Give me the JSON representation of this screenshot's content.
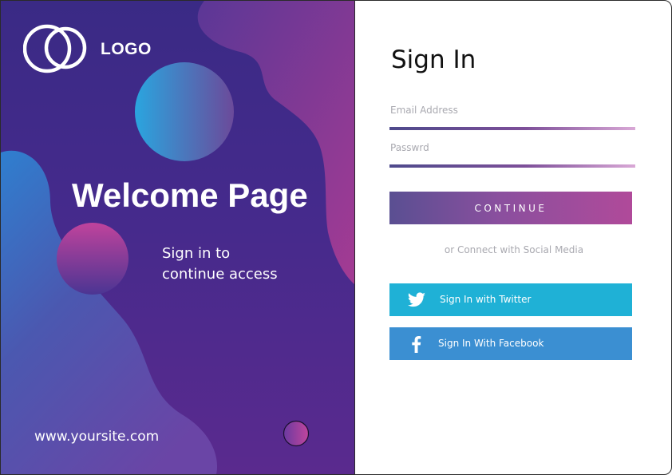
{
  "brand": {
    "logo_text": "LOGO",
    "welcome_title": "Welcome Page",
    "subtitle_line1": "Sign in to",
    "subtitle_line2": "continue access",
    "website": "www.yoursite.com"
  },
  "form": {
    "title": "Sign In",
    "email_placeholder": "Email Address",
    "email_value": "",
    "password_placeholder": "Passwrd",
    "password_value": "",
    "continue_label": "CONTINUE",
    "social_divider": "or Connect with Social Media",
    "twitter_label": "Sign In with Twitter",
    "facebook_label": "Sign In With Facebook"
  },
  "icons": {
    "logo": "interlocking-rings-icon",
    "twitter": "twitter-bird-icon",
    "facebook": "facebook-f-icon"
  },
  "colors": {
    "panel_purple": "#3a2a85",
    "accent_magenta": "#b04a9a",
    "twitter_blue": "#1fb1d6",
    "facebook_blue": "#3b8fd2",
    "placeholder_gray": "#a9a9b0"
  }
}
